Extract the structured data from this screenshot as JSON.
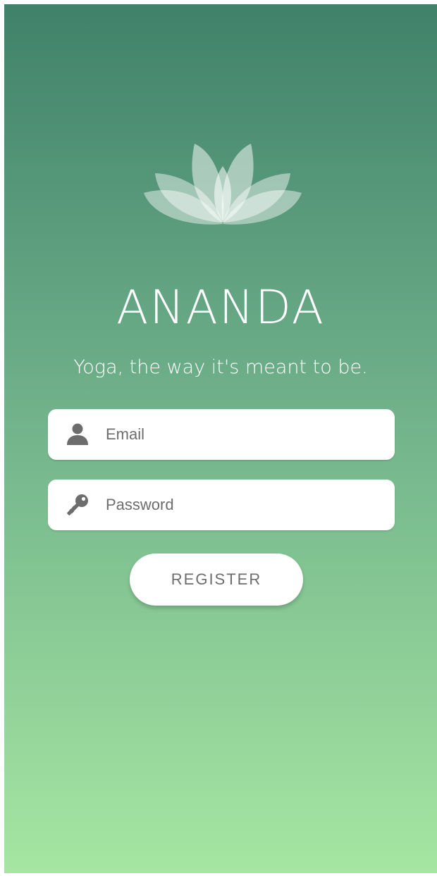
{
  "app": {
    "title": "ANANDA",
    "tagline": "Yoga, the way it's meant to be."
  },
  "logo": {
    "icon": "lotus-icon",
    "color": "#ffffff"
  },
  "form": {
    "email": {
      "placeholder": "Email",
      "value": "",
      "icon": "person-icon"
    },
    "password": {
      "placeholder": "Password",
      "value": "",
      "icon": "key-icon"
    },
    "register_label": "REGISTER"
  },
  "colors": {
    "gradient_top": "#40816a",
    "gradient_bottom": "#a6e6a2",
    "field_background": "#ffffff",
    "icon_gray": "#6d6d6d"
  }
}
